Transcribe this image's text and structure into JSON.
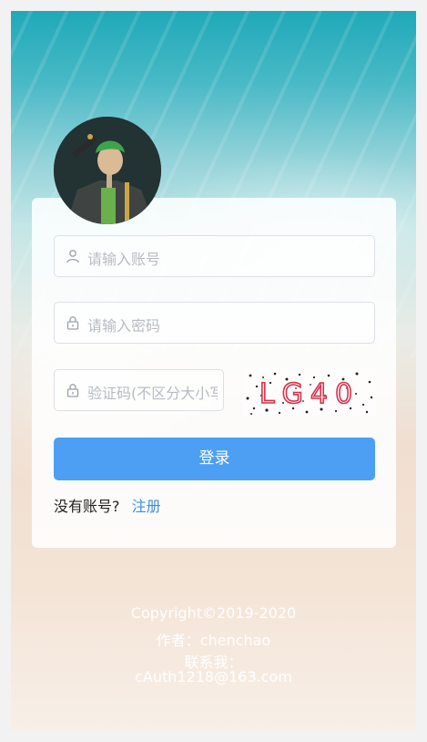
{
  "login": {
    "username_placeholder": "请输入账号",
    "password_placeholder": "请输入密码",
    "captcha_placeholder": "验证码(不区分大小写)",
    "captcha_text": "LG40",
    "login_button": "登录",
    "no_account_text": "没有账号?",
    "register_link": "注册"
  },
  "footer": {
    "copyright": "Copyright©2019-2020",
    "author": "作者：chenchao",
    "contact_label": "联系我：",
    "contact_email": "cAuth1218@163.com"
  },
  "icons": {
    "username": "user-icon",
    "password": "lock-icon",
    "captcha": "lock-icon"
  },
  "colors": {
    "primary": "#4d9ff4",
    "link": "#3d8fe0",
    "captcha_text": "#d6304c"
  }
}
